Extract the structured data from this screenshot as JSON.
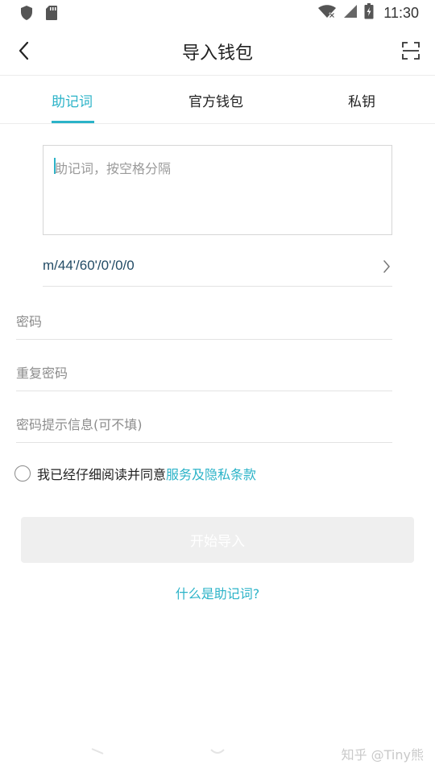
{
  "status_bar": {
    "time": "11:30",
    "icons": [
      "shield-icon",
      "sd-card-icon",
      "wifi-icon",
      "signal-icon",
      "battery-icon"
    ]
  },
  "app_bar": {
    "title": "导入钱包",
    "back_icon": "chevron-left-icon",
    "scan_icon": "scan-icon"
  },
  "tabs": [
    {
      "label": "助记词",
      "active": true
    },
    {
      "label": "官方钱包",
      "active": false
    },
    {
      "label": "私钥",
      "active": false
    }
  ],
  "form": {
    "mnemonic_placeholder": "助记词，按空格分隔",
    "derivation_path": "m/44'/60'/0'/0/0",
    "password_placeholder": "密码",
    "repeat_password_placeholder": "重复密码",
    "hint_placeholder": "密码提示信息(可不填)"
  },
  "agreement": {
    "text": "我已经仔细阅读并同意",
    "link": "服务及隐私条款"
  },
  "start_button": "开始导入",
  "what_is_link": "什么是助记词?",
  "watermark": "知乎 @Tiny熊",
  "colors": {
    "accent": "#2bb3c8",
    "path_text": "#234c66",
    "disabled_button": "#efefef"
  }
}
